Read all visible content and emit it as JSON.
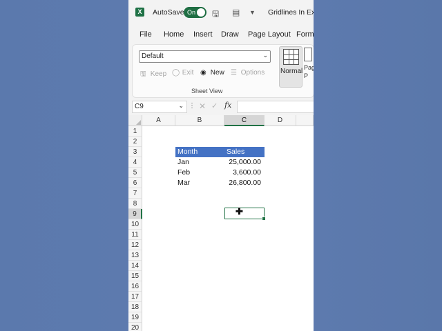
{
  "titlebar": {
    "autosave_label": "AutoSave",
    "toggle_label": "On",
    "doc_title": "Gridlines In Exce"
  },
  "menu": [
    "File",
    "Home",
    "Insert",
    "Draw",
    "Page Layout",
    "Form"
  ],
  "ribbon": {
    "sheet_view_value": "Default",
    "keep_label": "Keep",
    "exit_label": "Exit",
    "new_label": "New",
    "options_label": "Options",
    "group_label": "Sheet View",
    "normal_label": "Normal",
    "page_break_label_1": "Pag",
    "page_break_label_2": "P"
  },
  "formula_bar": {
    "name_box": "C9",
    "fx_label": "fx",
    "value": ""
  },
  "columns": [
    "A",
    "B",
    "C",
    "D"
  ],
  "selected_column": "C",
  "selected_row": "9",
  "rows": [
    "1",
    "2",
    "3",
    "4",
    "5",
    "6",
    "7",
    "8",
    "9",
    "10",
    "11",
    "12",
    "13",
    "14",
    "15",
    "16",
    "17",
    "18",
    "19",
    "20"
  ],
  "table": {
    "header": {
      "month": "Month",
      "sales": "Sales"
    },
    "rows": [
      {
        "month": "Jan",
        "sales": "25,000.00"
      },
      {
        "month": "Feb",
        "sales": "3,600.00"
      },
      {
        "month": "Mar",
        "sales": "26,800.00"
      }
    ]
  },
  "colors": {
    "excel_green": "#217346",
    "table_header": "#4472c4",
    "background": "#5a76a8"
  }
}
